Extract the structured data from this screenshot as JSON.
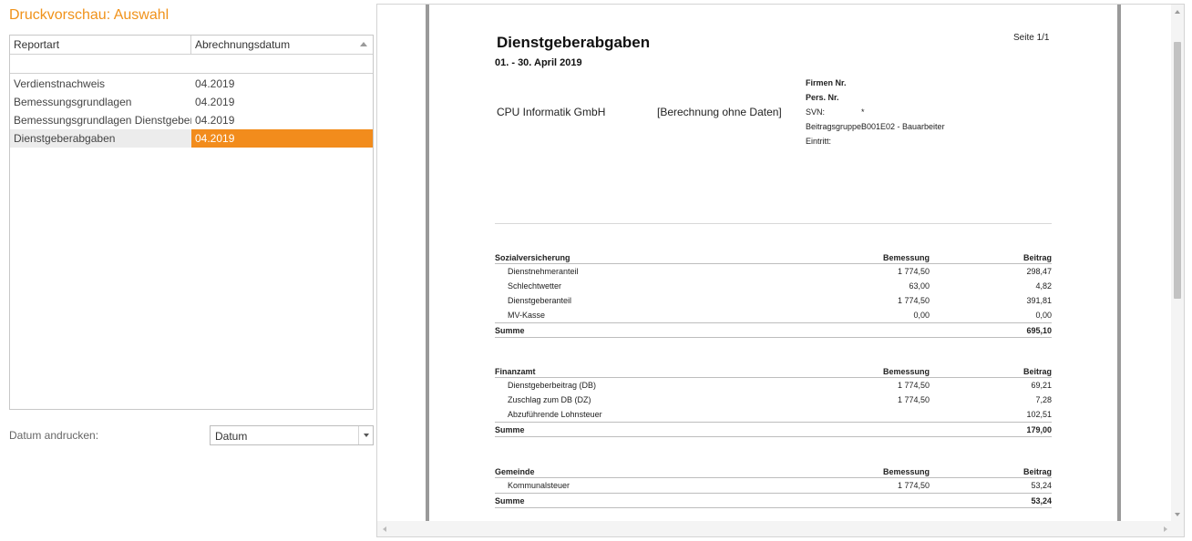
{
  "panel": {
    "title": "Druckvorschau: Auswahl"
  },
  "grid": {
    "columns": [
      "Reportart",
      "Abrechnungsdatum"
    ],
    "rows": [
      {
        "report": "Verdienstnachweis",
        "date": "04.2019"
      },
      {
        "report": "Bemessungsgrundlagen",
        "date": "04.2019"
      },
      {
        "report": "Bemessungsgrundlagen Dienstgeber",
        "date": "04.2019"
      },
      {
        "report": "Dienstgeberabgaben",
        "date": "04.2019"
      }
    ]
  },
  "options": {
    "date_label": "Datum andrucken:",
    "date_value": "Datum"
  },
  "report": {
    "title": "Dienstgeberabgaben",
    "page": "Seite 1/1",
    "period": "01. - 30. April 2019",
    "company": "CPU Informatik GmbH",
    "calc_note": "[Berechnung ohne Daten]",
    "info": {
      "firm_no": "Firmen Nr.",
      "pers_no": "Pers. Nr.",
      "svn_label": "SVN:",
      "svn_value": "*",
      "group_label": "Beitragsgruppe:",
      "group_value": "B001E02 - Bauarbeiter",
      "entry_label": "Eintritt:"
    },
    "sections": [
      {
        "name": "Sozialversicherung",
        "col_bem": "Bemessung",
        "col_bei": "Beitrag",
        "lines": [
          {
            "name": "Dienstnehmeranteil",
            "bem": "1 774,50",
            "bei": "298,47"
          },
          {
            "name": "Schlechtwetter",
            "bem": "63,00",
            "bei": "4,82"
          },
          {
            "name": "Dienstgeberanteil",
            "bem": "1 774,50",
            "bei": "391,81"
          },
          {
            "name": "MV-Kasse",
            "bem": "0,00",
            "bei": "0,00"
          }
        ],
        "sum_label": "Summe",
        "sum_value": "695,10"
      },
      {
        "name": "Finanzamt",
        "col_bem": "Bemessung",
        "col_bei": "Beitrag",
        "lines": [
          {
            "name": "Dienstgeberbeitrag (DB)",
            "bem": "1 774,50",
            "bei": "69,21"
          },
          {
            "name": "Zuschlag zum DB (DZ)",
            "bem": "1 774,50",
            "bei": "7,28"
          },
          {
            "name": "Abzuführende Lohnsteuer",
            "bem": "",
            "bei": "102,51"
          }
        ],
        "sum_label": "Summe",
        "sum_value": "179,00"
      },
      {
        "name": "Gemeinde",
        "col_bem": "Bemessung",
        "col_bei": "Beitrag",
        "lines": [
          {
            "name": "Kommunalsteuer",
            "bem": "1 774,50",
            "bei": "53,24"
          }
        ],
        "sum_label": "Summe",
        "sum_value": "53,24"
      }
    ]
  },
  "colors": {
    "accent": "#f28c1c",
    "title": "#f0921a"
  }
}
